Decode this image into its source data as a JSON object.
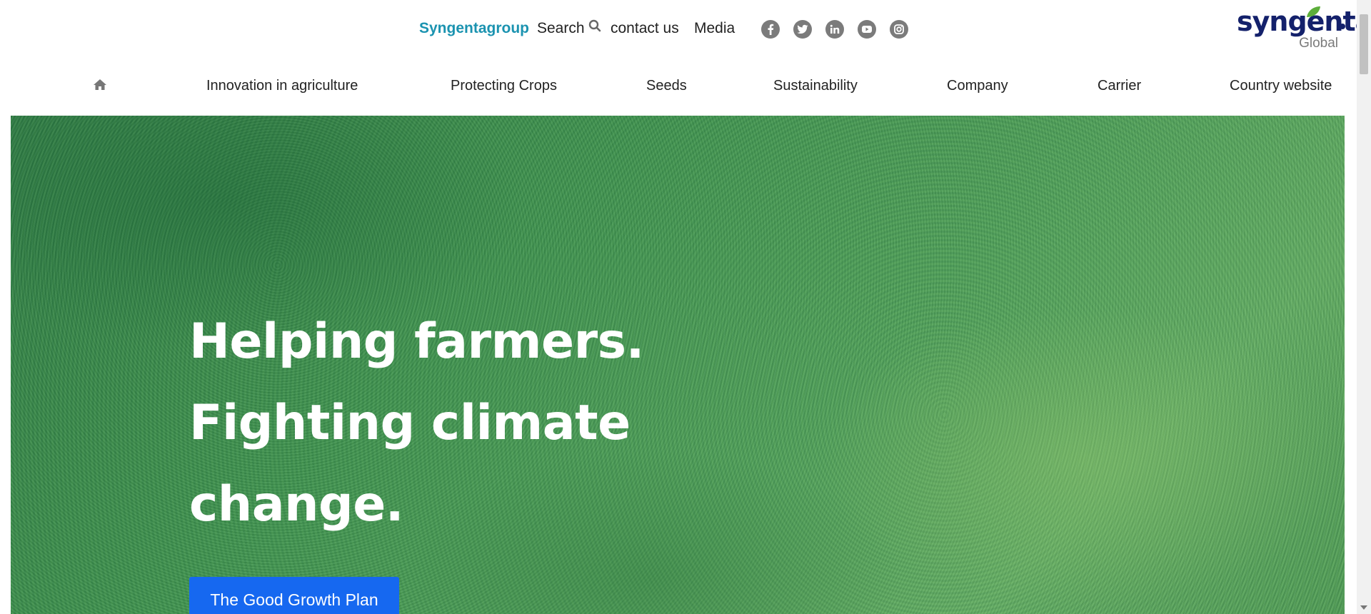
{
  "header": {
    "brand_link": "Syngentagroup",
    "search_label": "Search",
    "contact_label": "contact us",
    "media_label": "Media",
    "social": [
      "facebook-icon",
      "twitter-icon",
      "linkedin-icon",
      "youtube-icon",
      "instagram-icon"
    ]
  },
  "logo": {
    "word": "syngenta",
    "sub": "Global",
    "leaf_color": "#5cae3a",
    "word_color": "#14216b"
  },
  "nav": {
    "items": [
      {
        "label": "Innovation in agriculture"
      },
      {
        "label": "Protecting Crops"
      },
      {
        "label": "Seeds"
      },
      {
        "label": "Sustainability"
      },
      {
        "label": "Company"
      },
      {
        "label": "Carrier"
      },
      {
        "label": "Country website"
      }
    ]
  },
  "hero": {
    "lines": [
      "Helping farmers.",
      "Fighting climate",
      "change."
    ],
    "cta_label": "The Good Growth Plan"
  },
  "colors": {
    "accent": "#1b93b0",
    "cta": "#1668f0",
    "social_icon": "#7b7b7b"
  }
}
